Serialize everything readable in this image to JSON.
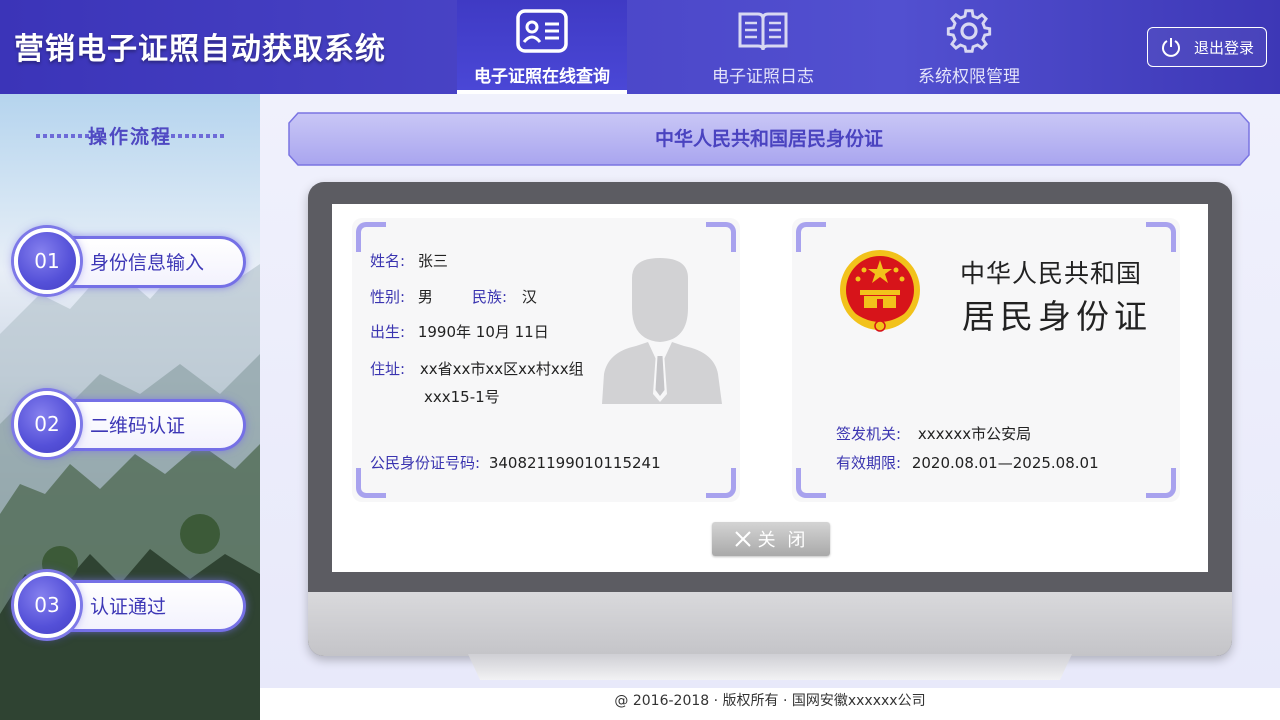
{
  "app": {
    "title": "营销电子证照自动获取系统"
  },
  "nav": {
    "tabs": [
      {
        "label": "电子证照在线查询",
        "icon": "id-card-icon",
        "active": true
      },
      {
        "label": "电子证照日志",
        "icon": "book-icon",
        "active": false
      },
      {
        "label": "系统权限管理",
        "icon": "gear-icon",
        "active": false
      }
    ],
    "logout_label": "退出登录"
  },
  "sidebar": {
    "title": "操作流程",
    "steps": [
      {
        "num": "01",
        "label": "身份信息输入"
      },
      {
        "num": "02",
        "label": "二维码认证"
      },
      {
        "num": "03",
        "label": "认证通过"
      }
    ]
  },
  "main": {
    "banner_title": "中华人民共和国居民身份证",
    "card_front": {
      "name_key": "姓名:",
      "name_val": "张三",
      "sex_key": "性别:",
      "sex_val": "男",
      "ethnic_key": "民族:",
      "ethnic_val": "汉",
      "birth_key": "出生:",
      "birth_val": "1990年 10月 11日",
      "addr_key": "住址:",
      "addr_line1": "xx省xx市xx区xx村xx组",
      "addr_line2": "xxx15-1号",
      "id_key": "公民身份证号码:",
      "id_val": "340821199010115241"
    },
    "card_back": {
      "title_line1": "中华人民共和国",
      "title_line2": "居民身份证",
      "authority_key": "签发机关:",
      "authority_val": "xxxxxx市公安局",
      "validity_key": "有效期限:",
      "validity_val": "2020.08.01—2025.08.01"
    },
    "close_label": "关 闭"
  },
  "footer": {
    "text": "@ 2016-2018  · 版权所有 ·  国网安徽xxxxxx公司"
  },
  "colors": {
    "primary": "#4a43c0",
    "accent": "#7570e6",
    "emblem_red": "#d7141a",
    "emblem_gold": "#f2c21b"
  }
}
